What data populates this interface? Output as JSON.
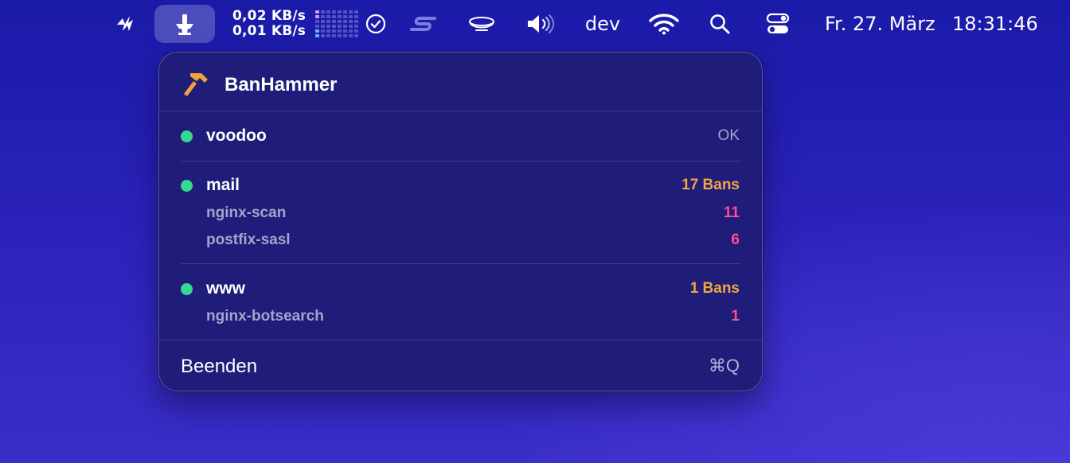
{
  "menubar": {
    "net_up": "0,02 KB/s",
    "net_down": "0,01 KB/s",
    "user_label": "dev",
    "date": "Fr. 27. März",
    "time": "18:31:46",
    "icons": [
      "activity-icon",
      "banhammer-anvil-icon",
      "network-bars-icon",
      "checkmark-circle-icon",
      "s-logo-icon",
      "bowl-icon",
      "volume-icon",
      "wifi-icon",
      "search-icon",
      "control-center-icon"
    ]
  },
  "popup": {
    "title": "BanHammer",
    "icon": "hammer-icon",
    "servers": [
      {
        "name": "voodoo",
        "status": "OK",
        "status_type": "ok",
        "jails": []
      },
      {
        "name": "mail",
        "status": "17 Bans",
        "status_type": "bans",
        "jails": [
          {
            "name": "nginx-scan",
            "count": "11"
          },
          {
            "name": "postfix-sasl",
            "count": "6"
          }
        ]
      },
      {
        "name": "www",
        "status": "1 Bans",
        "status_type": "bans",
        "jails": [
          {
            "name": "nginx-botsearch",
            "count": "1"
          }
        ]
      }
    ],
    "quit_label": "Beenden",
    "quit_shortcut": "⌘Q"
  },
  "colors": {
    "online_dot": "#35d98e",
    "bans_total": "#f1a640",
    "jail_count": "#ff4f97",
    "popup_bg": "#1f1c7a"
  }
}
